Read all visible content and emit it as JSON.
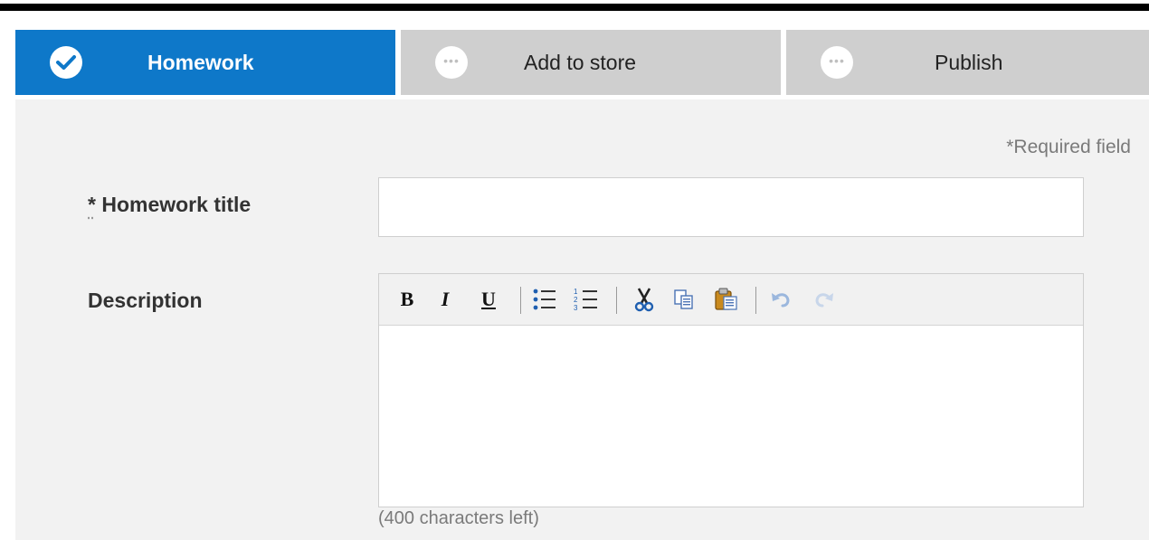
{
  "steps": [
    {
      "label": "Homework",
      "state": "active",
      "icon": "check-icon"
    },
    {
      "label": "Add to store",
      "state": "inactive",
      "icon": "dots-icon"
    },
    {
      "label": "Publish",
      "state": "inactive",
      "icon": "dots-icon"
    }
  ],
  "form": {
    "required_note": "*Required field",
    "title_asterisk": "*",
    "title_label": "Homework title",
    "title_value": "",
    "description_label": "Description",
    "description_value": "",
    "chars_left": "(400 characters left)"
  },
  "toolbar": {
    "bold_label": "B",
    "italic_label": "I",
    "underline_label": "U",
    "buttons": [
      "bold",
      "italic",
      "underline",
      "bulleted-list",
      "numbered-list",
      "cut",
      "copy",
      "paste",
      "undo",
      "redo"
    ]
  },
  "colors": {
    "accent": "#0e78c9",
    "inactive_step": "#cfcfcf",
    "panel_bg": "#f2f2f2"
  }
}
